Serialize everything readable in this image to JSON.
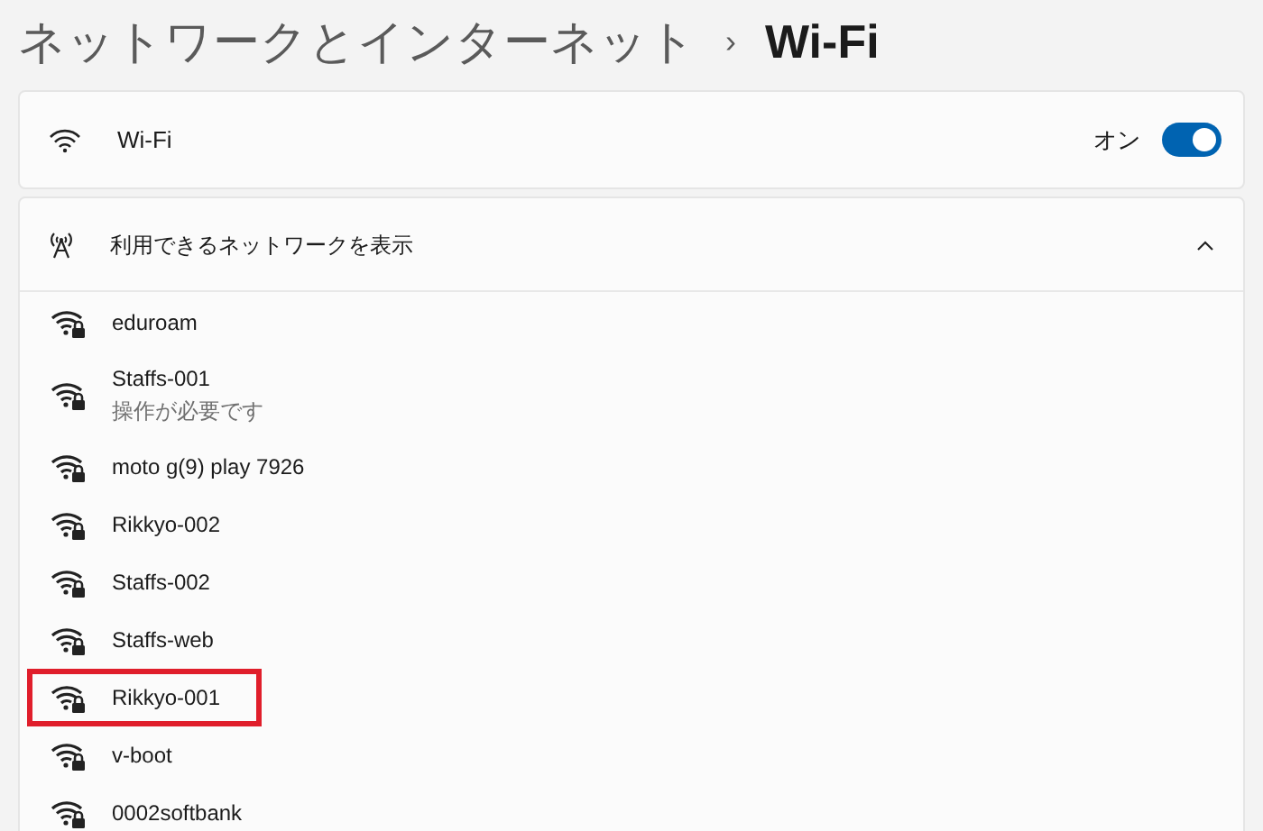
{
  "breadcrumb": {
    "parent": "ネットワークとインターネット",
    "separator": "›",
    "current": "Wi-Fi"
  },
  "wifi": {
    "label": "Wi-Fi",
    "state_text": "オン",
    "on": true
  },
  "networks_section": {
    "label": "利用できるネットワークを表示",
    "expanded": true
  },
  "networks": [
    {
      "name": "eduroam",
      "highlighted": false
    },
    {
      "name": "Staffs-001",
      "status": "操作が必要です",
      "highlighted": false
    },
    {
      "name": "moto g(9) play 7926",
      "highlighted": false
    },
    {
      "name": "Rikkyo-002",
      "highlighted": false
    },
    {
      "name": "Staffs-002",
      "highlighted": false
    },
    {
      "name": "Staffs-web",
      "highlighted": false
    },
    {
      "name": "Rikkyo-001",
      "highlighted": true
    },
    {
      "name": "v-boot",
      "highlighted": false
    },
    {
      "name": "0002softbank",
      "highlighted": false
    }
  ]
}
